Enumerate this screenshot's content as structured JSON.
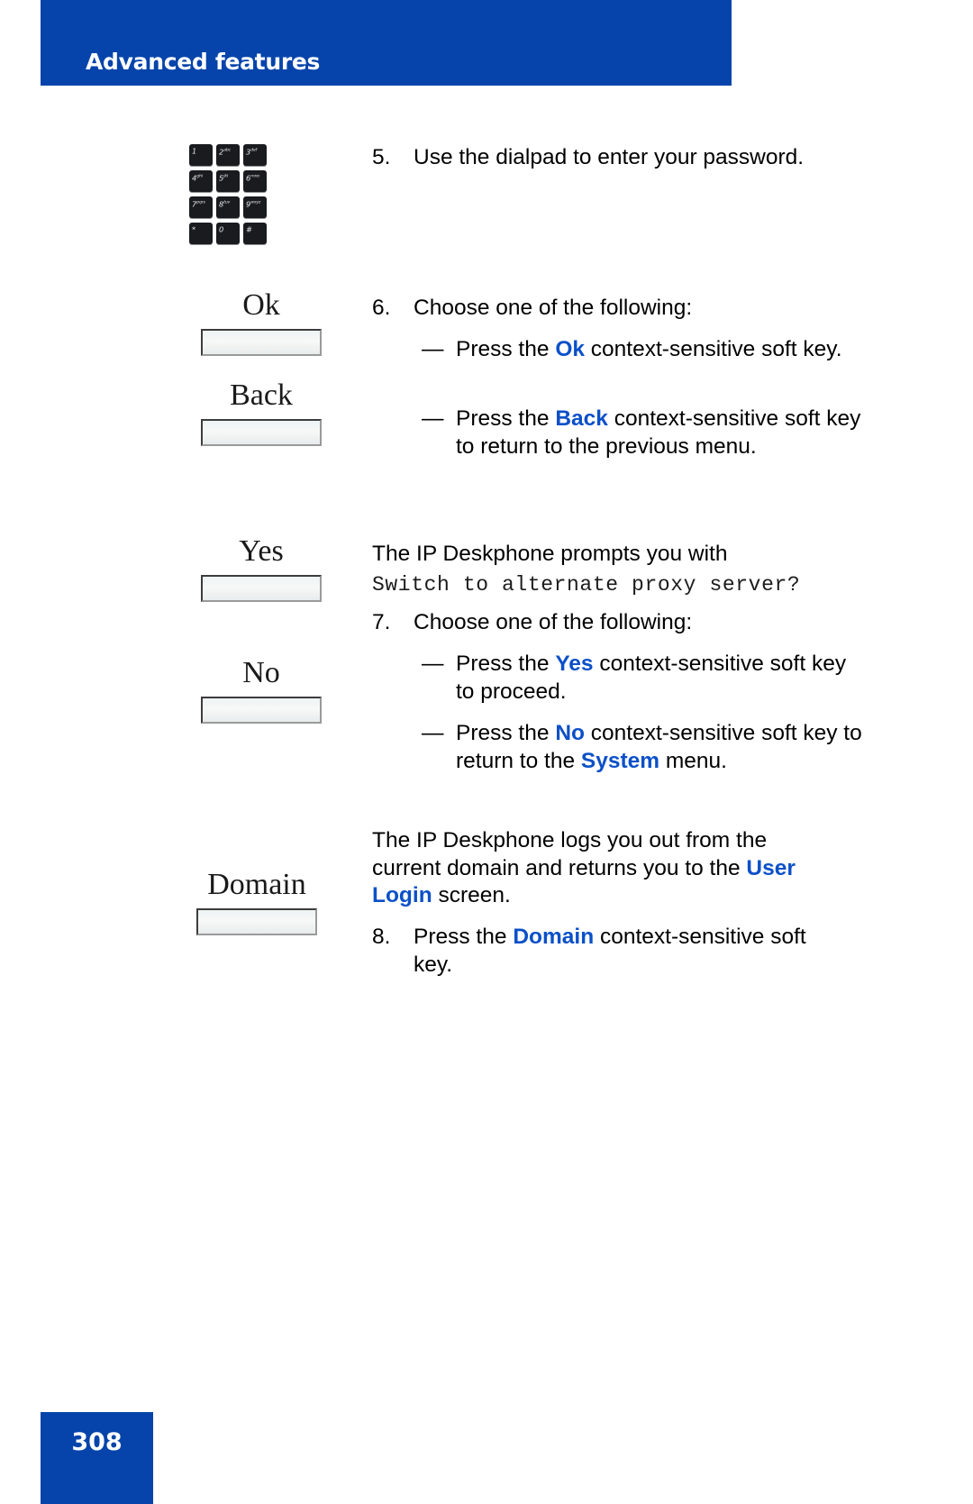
{
  "header": {
    "title": "Advanced features",
    "bar_color": "#0644ab"
  },
  "accent_color": "#0b50c8",
  "dialpad": {
    "name": "dialpad-icon",
    "keys": [
      {
        "digit": "1",
        "letters": ""
      },
      {
        "digit": "2",
        "letters": "abc"
      },
      {
        "digit": "3",
        "letters": "def"
      },
      {
        "digit": "4",
        "letters": "ghi"
      },
      {
        "digit": "5",
        "letters": "jkl"
      },
      {
        "digit": "6",
        "letters": "mno"
      },
      {
        "digit": "7",
        "letters": "pqrs"
      },
      {
        "digit": "8",
        "letters": "tuv"
      },
      {
        "digit": "9",
        "letters": "wxyz"
      },
      {
        "digit": "*",
        "letters": ""
      },
      {
        "digit": "0",
        "letters": ""
      },
      {
        "digit": "#",
        "letters": ""
      }
    ]
  },
  "softkeys": [
    {
      "id": "ok",
      "label": "Ok"
    },
    {
      "id": "back",
      "label": "Back"
    },
    {
      "id": "yes",
      "label": "Yes"
    },
    {
      "id": "no",
      "label": "No"
    },
    {
      "id": "domain",
      "label": "Domain"
    }
  ],
  "content": {
    "step5": {
      "number": "5.",
      "text": "Use the dialpad to enter your password."
    },
    "step6": {
      "number": "6.",
      "text": "Choose one of the following:"
    },
    "step6_items": [
      {
        "dash": "—",
        "prefix": "Press the ",
        "keyword": "Ok",
        "suffix": " context-sensitive soft key."
      },
      {
        "dash": "—",
        "prefix": "Press the ",
        "keyword": "Back",
        "suffix": " context-sensitive soft key to return to the previous menu."
      }
    ],
    "prompt_intro": "The IP Deskphone prompts you with",
    "prompt_text": "Switch to alternate proxy server?",
    "step7": {
      "number": "7.",
      "text": "Choose one of the following:"
    },
    "step7_items": [
      {
        "dash": "—",
        "prefix": "Press the ",
        "keyword": "Yes",
        "suffix": " context-sensitive soft key to proceed."
      },
      {
        "dash": "—",
        "prefix": "Press the ",
        "keyword": "No",
        "middle": " context-sensitive soft key to return to the ",
        "keyword2": "System",
        "suffix": " menu."
      }
    ],
    "logout_para": {
      "prefix": "The IP Deskphone logs you out from the current domain and returns you to the ",
      "keyword": "User Login",
      "suffix": " screen."
    },
    "step8": {
      "number": "8.",
      "prefix": "Press the ",
      "keyword": "Domain",
      "suffix": " context-sensitive soft key."
    }
  },
  "footer": {
    "page_number": "308"
  }
}
